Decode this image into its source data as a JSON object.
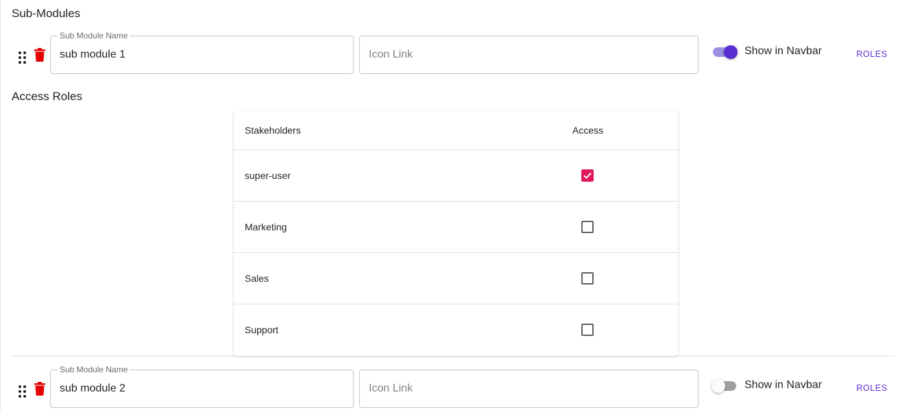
{
  "submodules_title": "Sub-Modules",
  "access_roles_title": "Access Roles",
  "submodules": [
    {
      "name_label": "Sub Module Name",
      "name_value": "sub module 1",
      "icon_placeholder": "Icon Link",
      "navbar_label": "Show in Navbar",
      "navbar_on": true,
      "roles_label": "ROLES"
    },
    {
      "name_label": "Sub Module Name",
      "name_value": "sub module 2",
      "icon_placeholder": "Icon Link",
      "navbar_label": "Show in Navbar",
      "navbar_on": false,
      "roles_label": "ROLES"
    }
  ],
  "roles_table": {
    "col_stakeholders": "Stakeholders",
    "col_access": "Access",
    "rows": [
      {
        "name": "super-user",
        "access": true
      },
      {
        "name": "Marketing",
        "access": false
      },
      {
        "name": "Sales",
        "access": false
      },
      {
        "name": "Support",
        "access": false
      }
    ]
  },
  "icons": {
    "drag": "drag-handle-icon",
    "delete": "trash-icon",
    "check": "check-icon"
  },
  "colors": {
    "accent": "#5b2ed2",
    "delete": "#e50000",
    "checkbox_checked": "#e0195a"
  }
}
